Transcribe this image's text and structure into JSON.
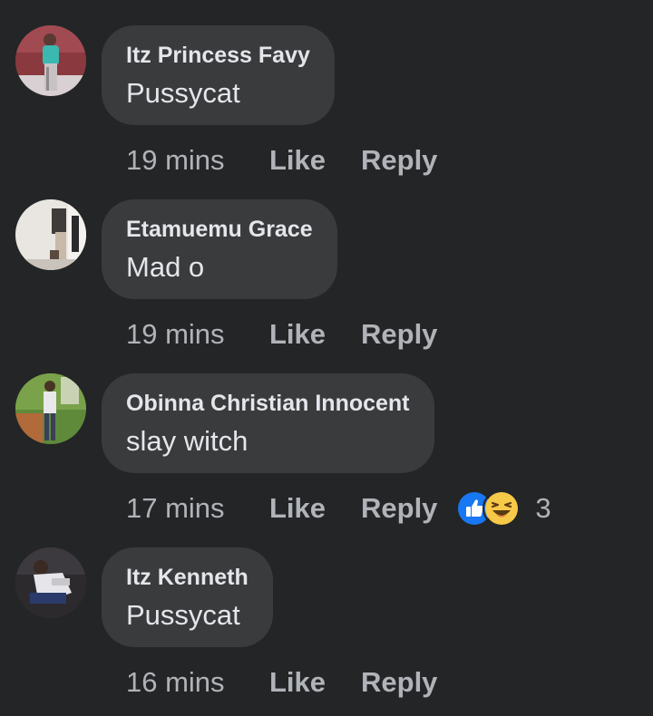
{
  "comments": [
    {
      "author": "Itz Princess Favy",
      "text": "Pussycat",
      "time": "19 mins",
      "like_label": "Like",
      "reply_label": "Reply"
    },
    {
      "author": "Etamuemu Grace",
      "text": "Mad o",
      "time": "19 mins",
      "like_label": "Like",
      "reply_label": "Reply"
    },
    {
      "author": "Obinna Christian Innocent",
      "text": "slay witch",
      "time": "17 mins",
      "like_label": "Like",
      "reply_label": "Reply",
      "reactions": {
        "icons": [
          "like-reaction-icon",
          "haha-reaction-icon"
        ],
        "count": "3"
      }
    },
    {
      "author": "Itz Kenneth",
      "text": "Pussycat",
      "time": "16 mins",
      "like_label": "Like",
      "reply_label": "Reply"
    }
  ],
  "colors": {
    "background": "#242526",
    "bubble": "#3a3b3c",
    "primary_text": "#e4e6eb",
    "secondary_text": "#b0b3b8",
    "like_reaction": "#1877f2",
    "haha_reaction": "#f7c948"
  }
}
